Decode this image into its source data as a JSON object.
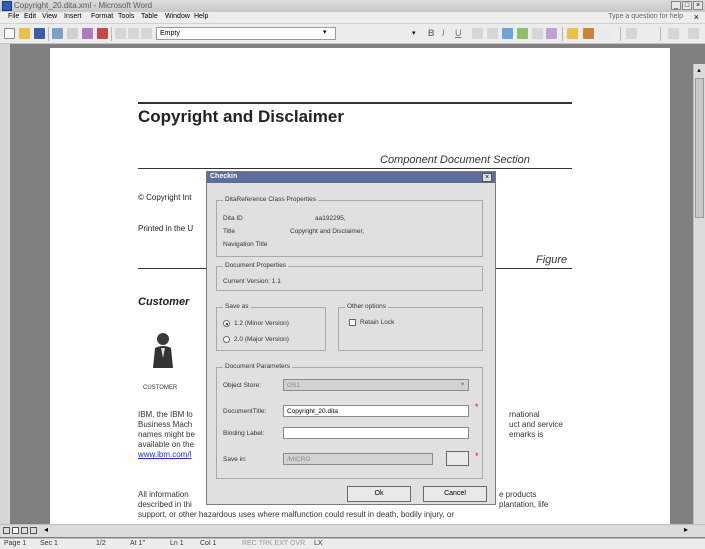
{
  "window": {
    "title": "Copyright_20.dita.xml - Microsoft Word",
    "controls": [
      "_",
      "□",
      "×"
    ]
  },
  "menu": {
    "items": [
      "File",
      "Edit",
      "View",
      "Insert",
      "Format",
      "Tools",
      "Table",
      "Window",
      "Help"
    ],
    "help_placeholder": "Type a question for help",
    "close_doc": "×"
  },
  "toolbar": {
    "style_value": "Empty",
    "format_buttons": [
      "B",
      "I",
      "U"
    ]
  },
  "document": {
    "title": "Copyright and Disclaimer",
    "section": "Component Document Section",
    "copyright": "© Copyright Int",
    "printed": "Printed in the U",
    "figure": "Figure",
    "customer_heading": "Customer",
    "customer_caption": "CUSTOMER",
    "para1_lines": [
      "IBM, the IBM lo",
      "Business Mach",
      "names might be",
      "available on the"
    ],
    "para1_right": [
      "rnational",
      "uct and service",
      "emarks is"
    ],
    "link": "www.ibm.com/l",
    "para2_line1": "All information",
    "para2_line1_right": "e products",
    "para2_line2": "described in thi",
    "para2_line2_right": "plantation, life",
    "para2_line3": "support, or other hazardous uses where malfunction could result in death, bodily injury, or"
  },
  "dialog": {
    "title": "Checkin",
    "close": "×",
    "class_props": {
      "legend": "DitaReference Class Properties",
      "dita_id_label": "Dita ID",
      "dita_id_value": "aa192295,",
      "title_label": "Title",
      "title_value": "Copyright and Disclaimer,",
      "nav_title_label": "Navigation Title"
    },
    "doc_props": {
      "legend": "Document Properties",
      "current_version": "Current Version: 1.1"
    },
    "save_as": {
      "legend": "Save as",
      "minor": "1.2 (Minor Version)",
      "major": "2.0 (Major Version)"
    },
    "other_options": {
      "legend": "Other options",
      "retain_lock": "Retain Lock"
    },
    "params": {
      "legend": "Document Parameters",
      "object_store_label": "Object Store:",
      "object_store_value": "OS1",
      "doc_title_label": "DocumentTitle:",
      "doc_title_value": "Copyright_20.dita",
      "binding_label": "Binding Label:",
      "binding_value": "",
      "save_in_label": "Save in:",
      "save_in_value": "/MICRO",
      "required_mark": "*"
    },
    "ok": "Ok",
    "cancel": "Cancel"
  },
  "status": {
    "page": "Page 1",
    "sec": "Sec 1",
    "pages": "1/2",
    "at": "At 1\"",
    "ln": "Ln 1",
    "col": "Col 1",
    "modes": "REC  TRK  EXT  OVR",
    "lang": "LX"
  },
  "colors": {
    "dialog_title": "#5b6f9a",
    "link": "#1a33cc",
    "required": "#dd1111"
  }
}
